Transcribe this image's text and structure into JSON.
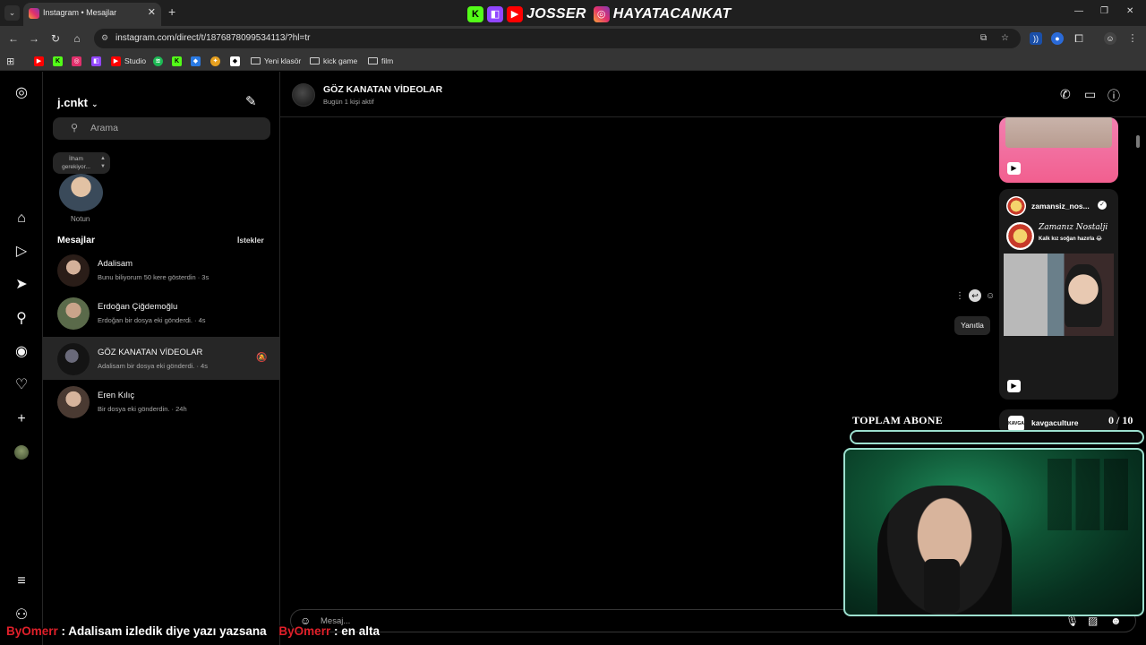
{
  "browser": {
    "tab_title": "Instagram • Mesajlar",
    "tab_close": "✕",
    "new_tab": "+",
    "url": "instagram.com/direct/t/1876878099534113/?hl=tr",
    "window_controls": [
      "—",
      "❐",
      "✕"
    ],
    "bookmarks": [
      {
        "label": "Studio",
        "icon": "youtube-icon"
      },
      {
        "label": "Yeni klasör",
        "icon": "folder-icon"
      },
      {
        "label": "kick game",
        "icon": "folder-icon"
      },
      {
        "label": "film",
        "icon": "folder-icon"
      }
    ]
  },
  "stream_brand": {
    "name1": "JOSSER",
    "name2": "HAYATACANKAT"
  },
  "inbox": {
    "username": "j.cnkt",
    "search_placeholder": "Arama",
    "note_text": "İlham gerekiyor...",
    "note_label": "Notun",
    "messages_header": "Mesajlar",
    "requests_label": "İstekler",
    "conversations": [
      {
        "name": "Adalisam",
        "preview": "Bunu biliyorum 50 kere gösterdin · 3s",
        "active": false
      },
      {
        "name": "Erdoğan Çiğdemoğlu",
        "preview": "Erdoğan bir dosya eki gönderdi. · 4s",
        "active": false
      },
      {
        "name": "GÖZ KANATAN VİDEOLAR",
        "preview": "Adalisam bir dosya eki gönderdi. · 4s",
        "active": true,
        "muted": true
      },
      {
        "name": "Eren Kılıç",
        "preview": "Bir dosya eki gönderdin. · 24h",
        "active": false
      }
    ]
  },
  "chat": {
    "title": "GÖZ KANATAN VİDEOLAR",
    "subtitle": "Bugün 1 kişi aktif",
    "reel_account": "zamansiz_nos...",
    "reel_brand": "Zamanız Nostalji",
    "reel_caption": "Kalk kız soğan hazırla 😂",
    "next_account": "kavgaculture",
    "tooltip": "Yanıtla",
    "composer_placeholder": "Mesaj..."
  },
  "overlay": {
    "subs_label": "TOPLAM ABONE",
    "subs_count": "0  / 10",
    "subs_progress": 0,
    "chat_user1": "ByOmerr",
    "chat_msg1": ": Adalisam izledik diye yazı yazsana",
    "chat_user2": "ByOmerr",
    "chat_msg2": ": en alta"
  },
  "colors": {
    "accent_overlay": "#9de0cf",
    "chat_user": "#e0202a",
    "active_row": "#262626"
  }
}
